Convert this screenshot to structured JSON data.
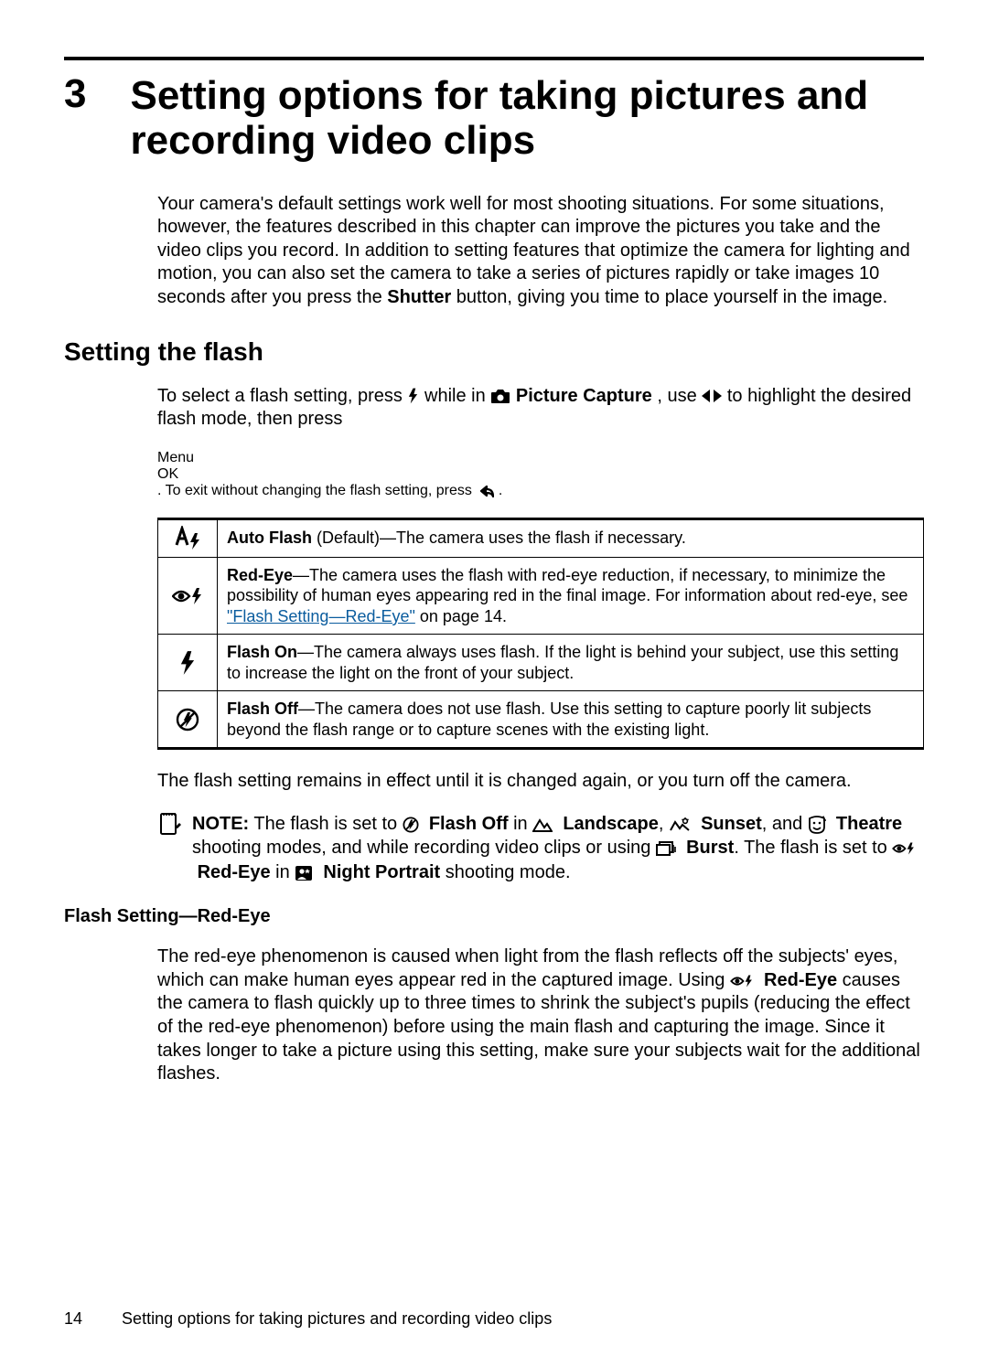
{
  "chapter": {
    "number": "3",
    "title": "Setting options for taking pictures and recording video clips"
  },
  "intro": {
    "p1a": "Your camera's default settings work well for most shooting situations. For some situations, however, the features described in this chapter can improve the pictures you take and the video clips you record. In addition to setting features that optimize the camera for lighting and motion, you can also set the camera to take a series of pictures rapidly or take images 10 seconds after you press the ",
    "p1b_bold": "Shutter",
    "p1c": " button, giving you time to place yourself in the image."
  },
  "section_flash": {
    "heading": "Setting the flash",
    "p_a": "To select a flash setting, press ",
    "p_b": " while in ",
    "p_c_bold": "Picture Capture",
    "p_d": ", use ",
    "p_e": " to highlight the desired flash mode, then press ",
    "p_f": ". To exit without changing the flash setting, press ",
    "p_g": ".",
    "menu_ok_top": "Menu",
    "menu_ok_bot": "OK",
    "rows": [
      {
        "bold": "Auto Flash",
        "rest": " (Default)—The camera uses the flash if necessary."
      },
      {
        "bold": "Red-Eye",
        "rest_a": "—The camera uses the flash with red-eye reduction, if necessary, to minimize the possibility of human eyes appearing red in the final image. For information about red-eye, see ",
        "link": "\"Flash Setting—Red-Eye\"",
        "rest_b": " on page 14."
      },
      {
        "bold": "Flash On",
        "rest": "—The camera always uses flash. If the light is behind your subject, use this setting to increase the light on the front of your subject."
      },
      {
        "bold": "Flash Off",
        "rest": "—The camera does not use flash. Use this setting to capture poorly lit subjects beyond the flash range or to capture scenes with the existing light."
      }
    ],
    "after_table": "The flash setting remains in effect until it is changed again, or you turn off the camera."
  },
  "note": {
    "lead": "NOTE:",
    "a": "  The flash is set to ",
    "flash_off_bold": "Flash Off",
    "in": " in ",
    "landscape_bold": "Landscape",
    "comma": ", ",
    "sunset_bold": "Sunset",
    "and": ", and ",
    "theatre_bold": "Theatre",
    "b": " shooting modes, and while recording video clips or using ",
    "burst_bold": "Burst",
    "c": ". The flash is set to ",
    "redeye_bold": "Red-Eye",
    "d": " in ",
    "night_bold": "Night Portrait",
    "e": " shooting mode."
  },
  "sub_redeye": {
    "heading": "Flash Setting—Red-Eye",
    "p_a": "The red-eye phenomenon is caused when light from the flash reflects off the subjects' eyes, which can make human eyes appear red in the captured image. Using ",
    "p_bold": "Red-Eye",
    "p_b": " causes the camera to flash quickly up to three times to shrink the subject's pupils (reducing the effect of the red-eye phenomenon) before using the main flash and capturing the image. Since it takes longer to take a picture using this setting, make sure your subjects wait for the additional flashes."
  },
  "footer": {
    "page": "14",
    "title": "Setting options for taking pictures and recording video clips"
  }
}
